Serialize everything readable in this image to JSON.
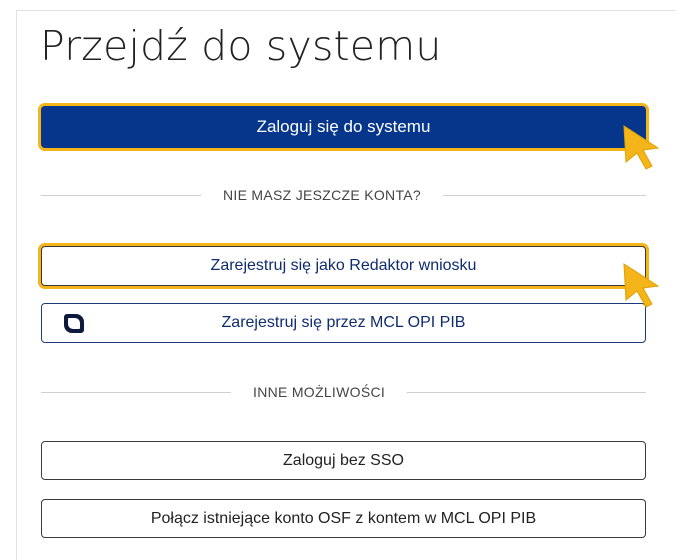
{
  "page": {
    "title": "Przejdź do systemu"
  },
  "buttons": {
    "login": "Zaloguj się do systemu",
    "register_editor": "Zarejestruj się jako Redaktor wniosku",
    "register_mcl": "Zarejestruj się przez MCL OPI PIB",
    "login_no_sso": "Zaloguj bez SSO",
    "connect_account": "Połącz istniejące konto OSF z kontem w MCL OPI PIB"
  },
  "dividers": {
    "no_account": "NIE MASZ JESZCZE KONTA?",
    "other_options": "INNE MOŻLIWOŚCI"
  },
  "icons": {
    "mcl_logo": "mcl-logo-icon",
    "pointer": "pointer-cursor-icon"
  },
  "colors": {
    "primary": "#05368b",
    "highlight": "#f3b51a",
    "cursor": "#f3b51a"
  }
}
